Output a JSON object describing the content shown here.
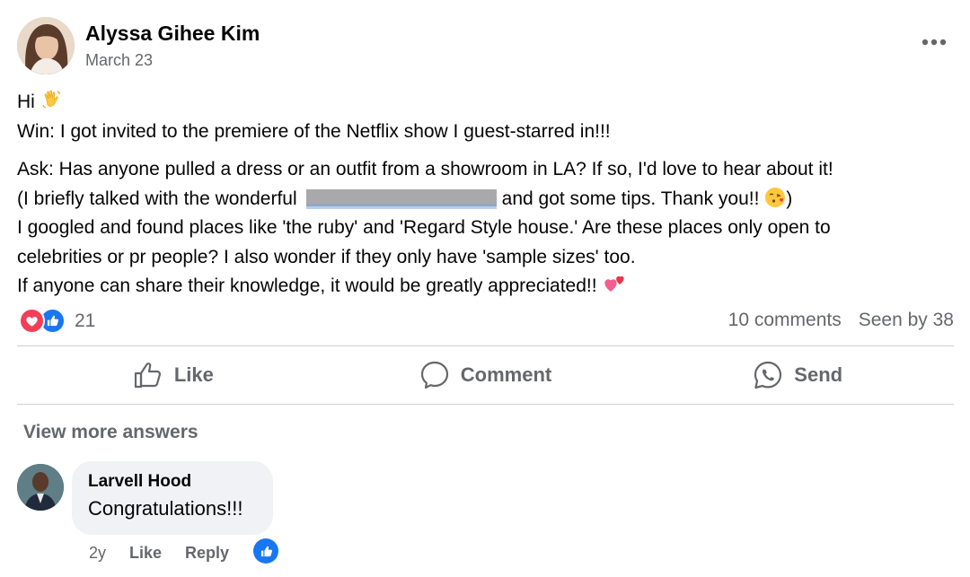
{
  "post": {
    "author": "Alyssa Gihee Kim",
    "date": "March 23",
    "avatar_icon": "profile-photo",
    "more_icon": "more-horizontal-icon",
    "line_hi": "Hi",
    "line_win": "Win: I got invited to the premiere of the Netflix show I guest-starred in!!!",
    "line_ask1": "Ask: Has anyone pulled a dress or an outfit from a showroom in LA? If so, I'd love to hear about it!",
    "line_ask2_start": "(I briefly talked with the wonderful",
    "line_ask2_end": "and got some tips. Thank you!!",
    "line_ask2_close": ")",
    "line_googled1": "I googled and found places like 'the ruby' and 'Regard Style house.' Are these places only open to",
    "line_googled2": "celebrities or pr people? I also wonder if they only have 'sample sizes' too.",
    "line_share": "If anyone can share their knowledge, it would be greatly appreciated!!"
  },
  "stats": {
    "reaction_count": "21",
    "comments": "10 comments",
    "seen": "Seen by 38"
  },
  "actions": {
    "like": "Like",
    "comment": "Comment",
    "send": "Send"
  },
  "comments": {
    "view_more": "View more answers",
    "items": [
      {
        "name": "Larvell Hood",
        "text": "Congratulations!!!",
        "age": "2y",
        "like": "Like",
        "reply": "Reply"
      }
    ]
  },
  "colors": {
    "primary_text": "#050505",
    "secondary_text": "#65676b",
    "like_blue": "#1877f2",
    "love_red": "#f33e58",
    "divider": "#ced0d4",
    "bubble_bg": "#f0f2f5"
  }
}
